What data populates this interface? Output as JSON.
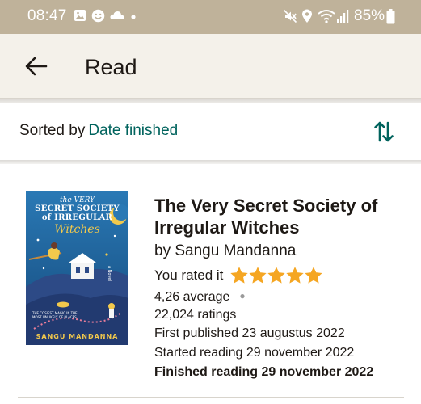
{
  "status_bar": {
    "time": "08:47",
    "battery": "85%",
    "icons": [
      "gallery-icon",
      "face-icon",
      "cloud-icon",
      "dot-icon",
      "mute-icon",
      "location-icon",
      "wifi-icon",
      "signal-icon",
      "battery-icon"
    ]
  },
  "app_bar": {
    "title": "Read",
    "back_icon": "arrow-back-icon"
  },
  "sort": {
    "label": "Sorted by",
    "value": "Date finished",
    "toggle_icon": "sort-arrows-icon"
  },
  "book": {
    "title": "The Very Secret Society of Irregular Witches",
    "author": "by Sangu Mandanna",
    "rated_label": "You rated it",
    "user_rating": 5,
    "average": "4,26 average",
    "ratings": "22,024 ratings",
    "first_published": "First published 23 augustus 2022",
    "started": "Started reading 29 november 2022",
    "finished": "Finished reading 29 november 2022",
    "cover": {
      "title_line1": "the VERY",
      "title_line2": "SECRET SOCIETY",
      "title_line3": "of IRREGULAR",
      "title_line4": "Witches",
      "tagline": "THE COSIEST MAGIC IN THE MOST UNLIKELY OF PLACES",
      "author": "SANGU MANDANNA",
      "side_text": "a Novel"
    }
  },
  "colors": {
    "status_bar": "#bfb29a",
    "app_bar": "#f4f1ea",
    "accent": "#00635d",
    "star": "#f5a623",
    "text": "#1e1915"
  }
}
